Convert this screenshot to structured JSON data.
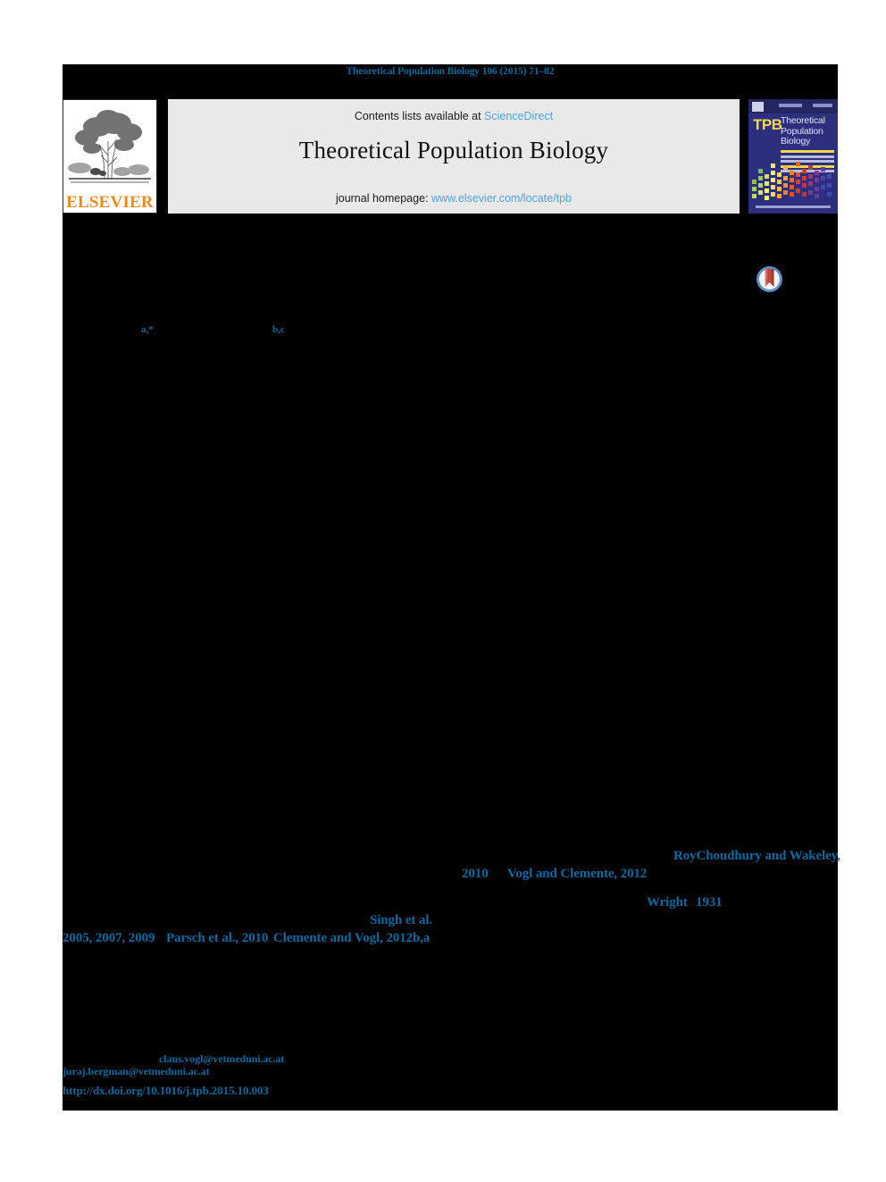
{
  "running_head": "Theoretical Population Biology 106 (2015) 71–82",
  "masthead": {
    "elsevier": {
      "wordmark": "ELSEVIER",
      "tree_icon": "elsevier-tree-icon",
      "wordmark_color": "#f08a1d"
    },
    "contents": {
      "prefix": "Contents lists available at ",
      "link": "ScienceDirect",
      "link_color": "#4ea3dd"
    },
    "journal_title": "Theoretical Population Biology",
    "homepage": {
      "prefix": "journal homepage: ",
      "link": "www.elsevier.com/locate/tpb",
      "link_color": "#4ea3dd"
    },
    "cover": {
      "abbrev": "TPB",
      "title_line_1": "Theoretical",
      "title_line_2": "Population",
      "title_line_3": "Biology",
      "background_color": "#2c2f7e",
      "abbrev_color": "#f2d64b"
    }
  },
  "crossmark": {
    "icon": "crossmark-badge-icon",
    "ring_color": "#5b8fc9",
    "mark_color": "#c0392b"
  },
  "authors": {
    "affiliation_marker_first": "a,*",
    "affiliation_marker_second": "b,c",
    "marker_color": "#0b6aa2"
  },
  "citations": [
    {
      "id": "roychoudhury",
      "text": "RoyChoudhury and Wakeley,"
    },
    {
      "id": "roychoudhury_year",
      "text": "2010"
    },
    {
      "id": "vogl_clemente",
      "text": "Vogl and Clemente, 2012"
    },
    {
      "id": "wright",
      "text": "Wright"
    },
    {
      "id": "wright_year",
      "text": "1931"
    },
    {
      "id": "singh",
      "text": "Singh et al."
    },
    {
      "id": "singh_years",
      "text": "2005, 2007, 2009"
    },
    {
      "id": "parsch",
      "text": "Parsch et al., 2010"
    },
    {
      "id": "clemente_vogl",
      "text": "Clemente and Vogl, 2012b,a"
    }
  ],
  "footnotes": {
    "email_corresponding": "claus.vogl@vetmeduni.ac.at",
    "email_second": "juraj.bergman@vetmeduni.ac.at",
    "doi_url": "http://dx.doi.org/10.1016/j.tpb.2015.10.003"
  },
  "colors": {
    "link_blue": "#0b6aa2",
    "masthead_link_blue": "#4ea3dd",
    "masked_body": "#000000",
    "contents_box": "#e9e9e9"
  }
}
